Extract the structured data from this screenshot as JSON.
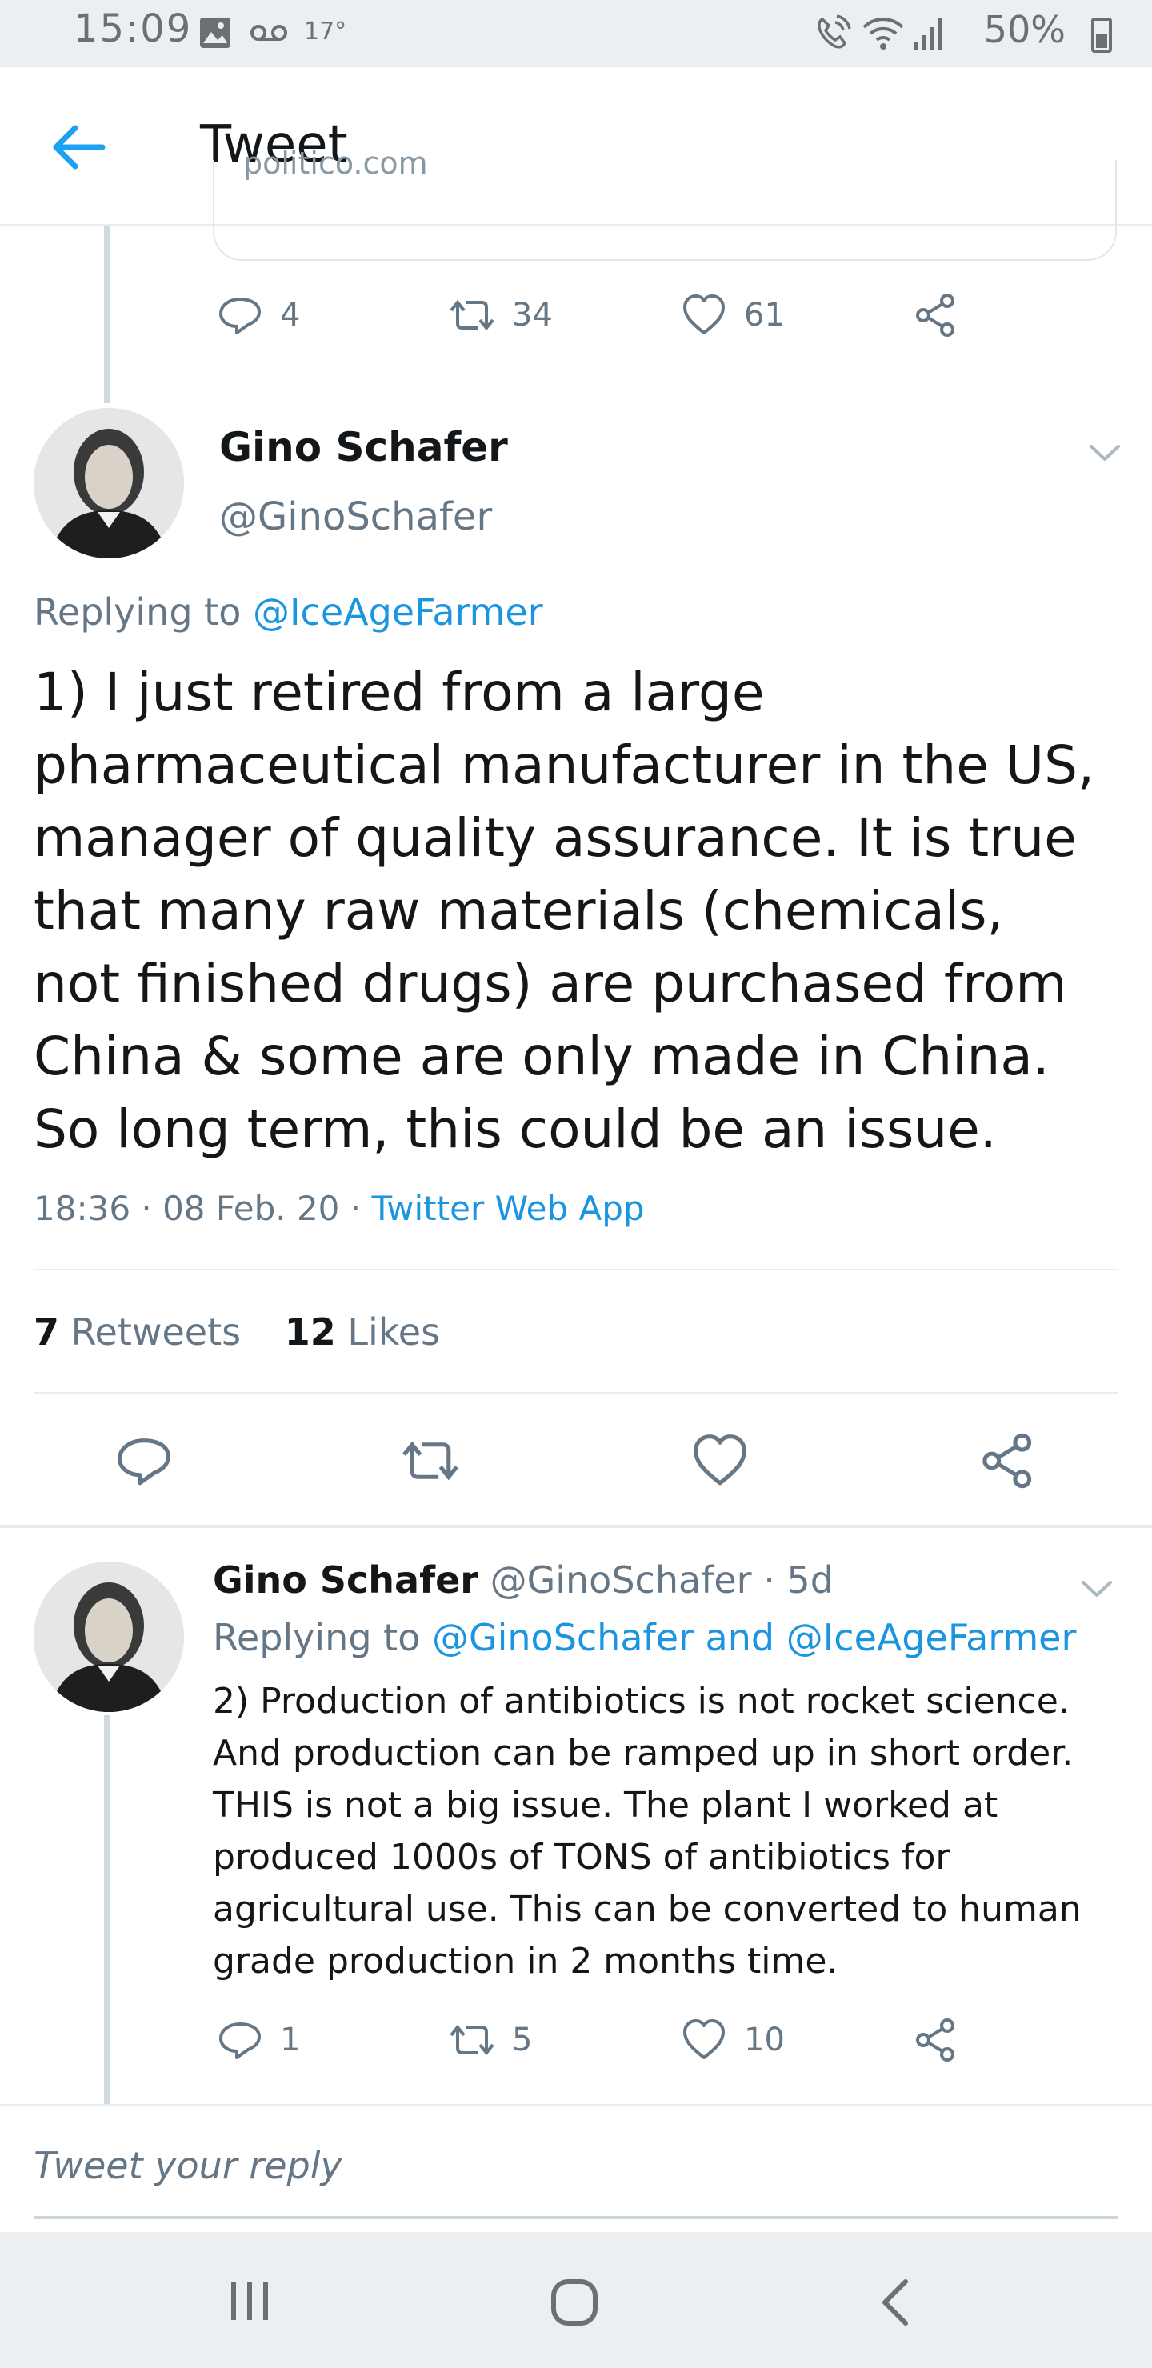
{
  "status_bar": {
    "time": "15:09",
    "temp": "17°",
    "battery": "50%",
    "battery_level": 0.5,
    "icons": [
      "image-icon",
      "voicemail-icon",
      "wifi-calling-icon",
      "wifi-icon",
      "signal-icon",
      "battery-icon"
    ]
  },
  "header": {
    "title": "Tweet",
    "back_icon": "back-arrow-icon"
  },
  "quoted_card": {
    "url_fragment": "politico.com"
  },
  "prev_tweet_actions": {
    "replies": "4",
    "retweets": "34",
    "likes": "61"
  },
  "main_tweet": {
    "name": "Gino Schafer",
    "handle": "@GinoSchafer",
    "replying_prefix": "Replying to",
    "replying_to": "@IceAgeFarmer",
    "text": "1) I just retired from a large pharmaceutical manufacturer in the US, manager of quality assurance. It is true that many raw materials (chemicals, not finished drugs) are purchased from China & some are only made in China. So long term, this could be an issue.",
    "timestamp": "18:36 · 08 Feb. 20 · ",
    "source": "Twitter Web App",
    "retweets_count": "7",
    "retweets_label": " Retweets",
    "likes_count": "12",
    "likes_label": " Likes"
  },
  "reply_tweet": {
    "name": "Gino Schafer",
    "handle_time": " @GinoSchafer · 5d",
    "replying_prefix": "Replying to ",
    "replying_to": "@GinoSchafer and @IceAgeFarmer",
    "text": "2) Production of antibiotics is not rocket science. And production can be ramped up in short order. THIS is not a big issue. The plant I worked at produced 1000s of TONS of antibiotics for agricultural use. This can be converted to human grade production in 2 months time.",
    "replies": "1",
    "retweets": "5",
    "likes": "10"
  },
  "compose": {
    "placeholder": "Tweet your reply"
  },
  "nav_bar": {
    "icons": [
      "recents-icon",
      "home-icon",
      "back-icon"
    ]
  },
  "colors": {
    "accent": "#1da1f2",
    "link": "#1b95e0",
    "secondary_text": "#657786",
    "divider": "#e6ecf0",
    "bars": "#eceff1"
  }
}
